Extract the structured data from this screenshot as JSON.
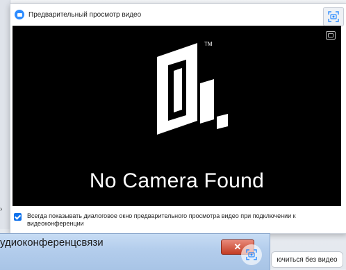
{
  "dialog": {
    "title": "Предварительный просмотр видео",
    "video_message": "No Camera Found",
    "logo_tm": "TM",
    "always_show_checked": true,
    "always_show_label": "Всегда показывать диалоговое окно предварительного просмотра видео при подключении к видеоконференции"
  },
  "audio_window": {
    "title": "удиоконференцсвязи",
    "close_label": "✕"
  },
  "join_without_video_label": "ючиться без видео",
  "icons": {
    "app_logo": "zoom-logo-icon",
    "screenshot_tile": "screenshot-tile-icon",
    "frame": "frame-icon"
  },
  "colors": {
    "accent": "#0e71eb",
    "video_bg": "#000000",
    "close_red": "#c33c24"
  }
}
